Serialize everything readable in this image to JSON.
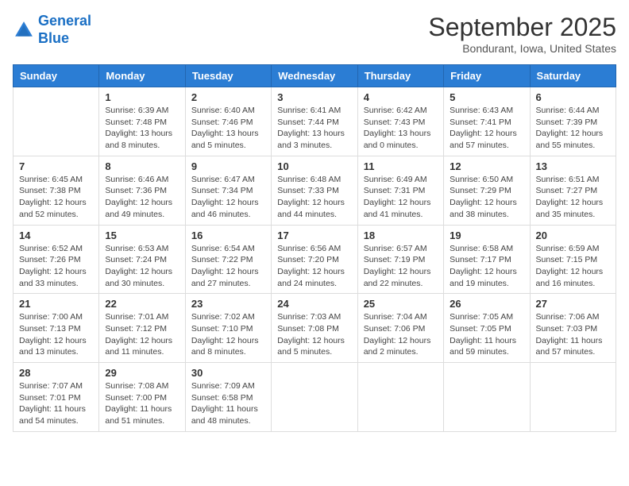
{
  "header": {
    "logo_line1": "General",
    "logo_line2": "Blue",
    "month_title": "September 2025",
    "location": "Bondurant, Iowa, United States"
  },
  "days_of_week": [
    "Sunday",
    "Monday",
    "Tuesday",
    "Wednesday",
    "Thursday",
    "Friday",
    "Saturday"
  ],
  "weeks": [
    [
      {
        "day": "",
        "sunrise": "",
        "sunset": "",
        "daylight": ""
      },
      {
        "day": "1",
        "sunrise": "Sunrise: 6:39 AM",
        "sunset": "Sunset: 7:48 PM",
        "daylight": "Daylight: 13 hours and 8 minutes."
      },
      {
        "day": "2",
        "sunrise": "Sunrise: 6:40 AM",
        "sunset": "Sunset: 7:46 PM",
        "daylight": "Daylight: 13 hours and 5 minutes."
      },
      {
        "day": "3",
        "sunrise": "Sunrise: 6:41 AM",
        "sunset": "Sunset: 7:44 PM",
        "daylight": "Daylight: 13 hours and 3 minutes."
      },
      {
        "day": "4",
        "sunrise": "Sunrise: 6:42 AM",
        "sunset": "Sunset: 7:43 PM",
        "daylight": "Daylight: 13 hours and 0 minutes."
      },
      {
        "day": "5",
        "sunrise": "Sunrise: 6:43 AM",
        "sunset": "Sunset: 7:41 PM",
        "daylight": "Daylight: 12 hours and 57 minutes."
      },
      {
        "day": "6",
        "sunrise": "Sunrise: 6:44 AM",
        "sunset": "Sunset: 7:39 PM",
        "daylight": "Daylight: 12 hours and 55 minutes."
      }
    ],
    [
      {
        "day": "7",
        "sunrise": "Sunrise: 6:45 AM",
        "sunset": "Sunset: 7:38 PM",
        "daylight": "Daylight: 12 hours and 52 minutes."
      },
      {
        "day": "8",
        "sunrise": "Sunrise: 6:46 AM",
        "sunset": "Sunset: 7:36 PM",
        "daylight": "Daylight: 12 hours and 49 minutes."
      },
      {
        "day": "9",
        "sunrise": "Sunrise: 6:47 AM",
        "sunset": "Sunset: 7:34 PM",
        "daylight": "Daylight: 12 hours and 46 minutes."
      },
      {
        "day": "10",
        "sunrise": "Sunrise: 6:48 AM",
        "sunset": "Sunset: 7:33 PM",
        "daylight": "Daylight: 12 hours and 44 minutes."
      },
      {
        "day": "11",
        "sunrise": "Sunrise: 6:49 AM",
        "sunset": "Sunset: 7:31 PM",
        "daylight": "Daylight: 12 hours and 41 minutes."
      },
      {
        "day": "12",
        "sunrise": "Sunrise: 6:50 AM",
        "sunset": "Sunset: 7:29 PM",
        "daylight": "Daylight: 12 hours and 38 minutes."
      },
      {
        "day": "13",
        "sunrise": "Sunrise: 6:51 AM",
        "sunset": "Sunset: 7:27 PM",
        "daylight": "Daylight: 12 hours and 35 minutes."
      }
    ],
    [
      {
        "day": "14",
        "sunrise": "Sunrise: 6:52 AM",
        "sunset": "Sunset: 7:26 PM",
        "daylight": "Daylight: 12 hours and 33 minutes."
      },
      {
        "day": "15",
        "sunrise": "Sunrise: 6:53 AM",
        "sunset": "Sunset: 7:24 PM",
        "daylight": "Daylight: 12 hours and 30 minutes."
      },
      {
        "day": "16",
        "sunrise": "Sunrise: 6:54 AM",
        "sunset": "Sunset: 7:22 PM",
        "daylight": "Daylight: 12 hours and 27 minutes."
      },
      {
        "day": "17",
        "sunrise": "Sunrise: 6:56 AM",
        "sunset": "Sunset: 7:20 PM",
        "daylight": "Daylight: 12 hours and 24 minutes."
      },
      {
        "day": "18",
        "sunrise": "Sunrise: 6:57 AM",
        "sunset": "Sunset: 7:19 PM",
        "daylight": "Daylight: 12 hours and 22 minutes."
      },
      {
        "day": "19",
        "sunrise": "Sunrise: 6:58 AM",
        "sunset": "Sunset: 7:17 PM",
        "daylight": "Daylight: 12 hours and 19 minutes."
      },
      {
        "day": "20",
        "sunrise": "Sunrise: 6:59 AM",
        "sunset": "Sunset: 7:15 PM",
        "daylight": "Daylight: 12 hours and 16 minutes."
      }
    ],
    [
      {
        "day": "21",
        "sunrise": "Sunrise: 7:00 AM",
        "sunset": "Sunset: 7:13 PM",
        "daylight": "Daylight: 12 hours and 13 minutes."
      },
      {
        "day": "22",
        "sunrise": "Sunrise: 7:01 AM",
        "sunset": "Sunset: 7:12 PM",
        "daylight": "Daylight: 12 hours and 11 minutes."
      },
      {
        "day": "23",
        "sunrise": "Sunrise: 7:02 AM",
        "sunset": "Sunset: 7:10 PM",
        "daylight": "Daylight: 12 hours and 8 minutes."
      },
      {
        "day": "24",
        "sunrise": "Sunrise: 7:03 AM",
        "sunset": "Sunset: 7:08 PM",
        "daylight": "Daylight: 12 hours and 5 minutes."
      },
      {
        "day": "25",
        "sunrise": "Sunrise: 7:04 AM",
        "sunset": "Sunset: 7:06 PM",
        "daylight": "Daylight: 12 hours and 2 minutes."
      },
      {
        "day": "26",
        "sunrise": "Sunrise: 7:05 AM",
        "sunset": "Sunset: 7:05 PM",
        "daylight": "Daylight: 11 hours and 59 minutes."
      },
      {
        "day": "27",
        "sunrise": "Sunrise: 7:06 AM",
        "sunset": "Sunset: 7:03 PM",
        "daylight": "Daylight: 11 hours and 57 minutes."
      }
    ],
    [
      {
        "day": "28",
        "sunrise": "Sunrise: 7:07 AM",
        "sunset": "Sunset: 7:01 PM",
        "daylight": "Daylight: 11 hours and 54 minutes."
      },
      {
        "day": "29",
        "sunrise": "Sunrise: 7:08 AM",
        "sunset": "Sunset: 7:00 PM",
        "daylight": "Daylight: 11 hours and 51 minutes."
      },
      {
        "day": "30",
        "sunrise": "Sunrise: 7:09 AM",
        "sunset": "Sunset: 6:58 PM",
        "daylight": "Daylight: 11 hours and 48 minutes."
      },
      {
        "day": "",
        "sunrise": "",
        "sunset": "",
        "daylight": ""
      },
      {
        "day": "",
        "sunrise": "",
        "sunset": "",
        "daylight": ""
      },
      {
        "day": "",
        "sunrise": "",
        "sunset": "",
        "daylight": ""
      },
      {
        "day": "",
        "sunrise": "",
        "sunset": "",
        "daylight": ""
      }
    ]
  ]
}
